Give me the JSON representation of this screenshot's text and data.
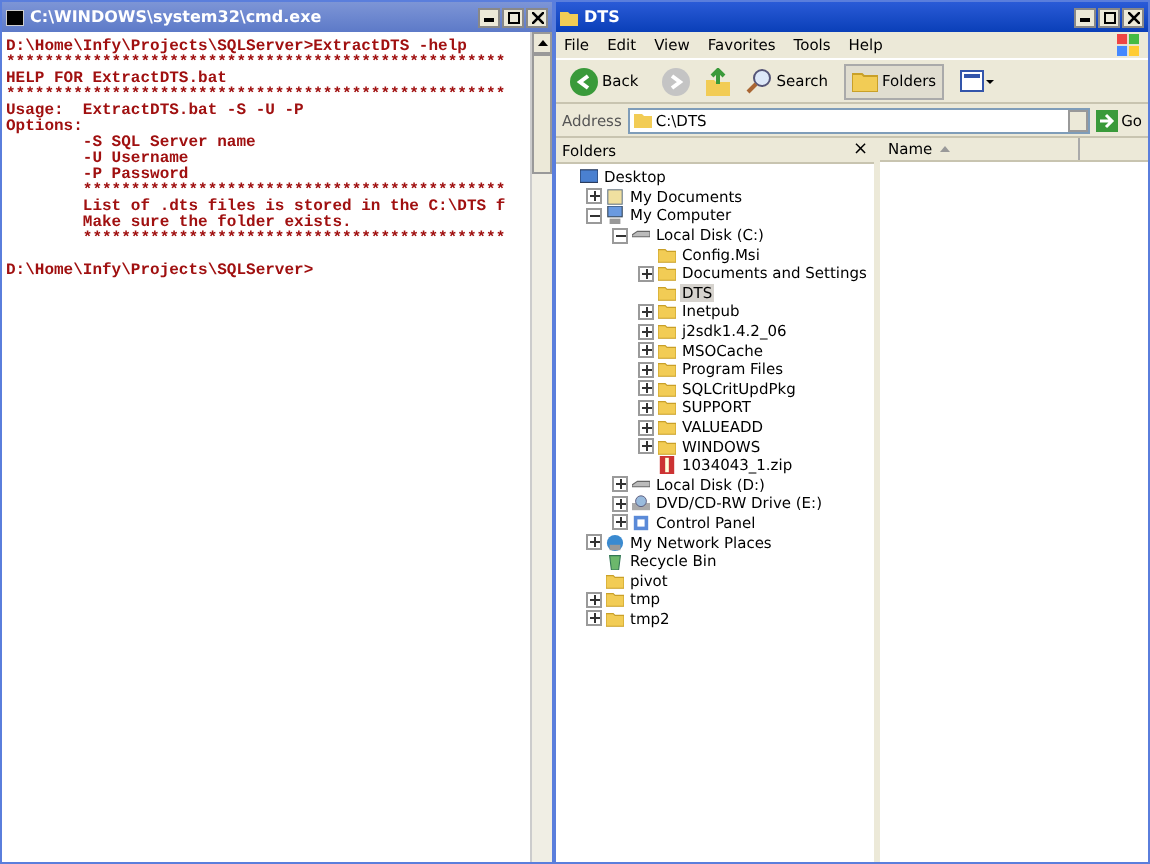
{
  "console": {
    "title": "C:\\WINDOWS\\system32\\cmd.exe",
    "output": [
      "D:\\Home\\Infy\\Projects\\SQLServer>ExtractDTS -help",
      "****************************************************",
      "HELP FOR ExtractDTS.bat",
      "****************************************************",
      "Usage:  ExtractDTS.bat -S -U -P",
      "Options:",
      "        -S SQL Server name",
      "        -U Username",
      "        -P Password",
      "        ********************************************",
      "        List of .dts files is stored in the C:\\DTS f",
      "        Make sure the folder exists.",
      "        ********************************************"
    ],
    "prompt": "D:\\Home\\Infy\\Projects\\SQLServer>"
  },
  "explorer": {
    "title": "DTS",
    "menu": [
      "File",
      "Edit",
      "View",
      "Favorites",
      "Tools",
      "Help"
    ],
    "toolbar": {
      "back": "Back",
      "search": "Search",
      "folders": "Folders"
    },
    "address": {
      "label": "Address",
      "value": "C:\\DTS",
      "go": "Go"
    },
    "folders_pane": {
      "title": "Folders",
      "close": "×",
      "tree": [
        {
          "label": "Desktop",
          "kind": "desktop",
          "selected": false,
          "children": [
            {
              "label": "My Documents",
              "kind": "documents",
              "expanded": false,
              "selected": false
            },
            {
              "label": "My Computer",
              "kind": "computer",
              "expanded": true,
              "selected": false,
              "children": [
                {
                  "label": "Local Disk (C:)",
                  "kind": "drive",
                  "expanded": true,
                  "selected": false,
                  "children": [
                    {
                      "label": "Config.Msi",
                      "kind": "folder",
                      "selected": false
                    },
                    {
                      "label": "Documents and Settings",
                      "kind": "folder",
                      "expanded": false,
                      "selected": false
                    },
                    {
                      "label": "DTS",
                      "kind": "folder",
                      "selected": true
                    },
                    {
                      "label": "Inetpub",
                      "kind": "folder",
                      "expanded": false,
                      "selected": false
                    },
                    {
                      "label": "j2sdk1.4.2_06",
                      "kind": "folder",
                      "expanded": false,
                      "selected": false
                    },
                    {
                      "label": "MSOCache",
                      "kind": "folder",
                      "expanded": false,
                      "selected": false
                    },
                    {
                      "label": "Program Files",
                      "kind": "folder",
                      "expanded": false,
                      "selected": false
                    },
                    {
                      "label": "SQLCritUpdPkg",
                      "kind": "folder",
                      "expanded": false,
                      "selected": false
                    },
                    {
                      "label": "SUPPORT",
                      "kind": "folder",
                      "expanded": false,
                      "selected": false
                    },
                    {
                      "label": "VALUEADD",
                      "kind": "folder",
                      "expanded": false,
                      "selected": false
                    },
                    {
                      "label": "WINDOWS",
                      "kind": "folder",
                      "expanded": false,
                      "selected": false
                    },
                    {
                      "label": "1034043_1.zip",
                      "kind": "zip",
                      "selected": false
                    }
                  ]
                },
                {
                  "label": "Local Disk (D:)",
                  "kind": "drive",
                  "expanded": false,
                  "selected": false
                },
                {
                  "label": "DVD/CD-RW Drive (E:)",
                  "kind": "cdrom",
                  "expanded": false,
                  "selected": false
                },
                {
                  "label": "Control Panel",
                  "kind": "control",
                  "expanded": false,
                  "selected": false
                }
              ]
            },
            {
              "label": "My Network Places",
              "kind": "network",
              "expanded": false,
              "selected": false
            },
            {
              "label": "Recycle Bin",
              "kind": "recycle",
              "selected": false
            },
            {
              "label": "pivot",
              "kind": "folder",
              "selected": false
            },
            {
              "label": "tmp",
              "kind": "folder",
              "expanded": false,
              "selected": false
            },
            {
              "label": "tmp2",
              "kind": "folder",
              "expanded": false,
              "selected": false
            }
          ]
        }
      ]
    },
    "list": {
      "columns": [
        {
          "label": "Name",
          "sorted": true
        }
      ]
    }
  }
}
